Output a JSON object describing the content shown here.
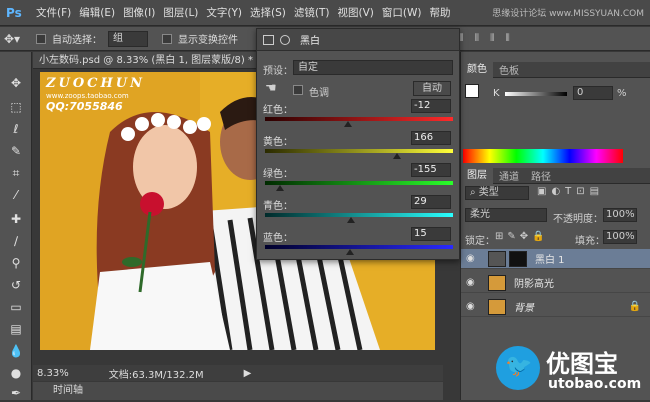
{
  "menubar": {
    "app_logo": "Ps",
    "items": [
      "文件(F)",
      "编辑(E)",
      "图像(I)",
      "图层(L)",
      "文字(Y)",
      "选择(S)",
      "滤镜(T)",
      "视图(V)",
      "窗口(W)",
      "帮助"
    ],
    "watermark": "思缘设计论坛 www.MISSYUAN.COM"
  },
  "options": {
    "auto_select_label": "自动选择：",
    "auto_select_value": "组",
    "transform_label": "显示变换控件"
  },
  "document": {
    "tab_title": "小左数码.psd @ 8.33% (黑白 1, 图层蒙版/8) *",
    "zoom": "8.33%",
    "doc_info": "文档:63.3M/132.2M",
    "timeline": "时间轴",
    "overlay_brand": "ZUOCHUN",
    "overlay_url": "www.zoops.taobao.com",
    "overlay_qq": "QQ:7055846"
  },
  "properties": {
    "title": "黑白",
    "preset_label": "预设：",
    "preset_value": "自定",
    "tint_label": "色调",
    "auto_label": "自动",
    "sliders": [
      {
        "label": "红色：",
        "value": "-12",
        "pos": 0.44,
        "colors": [
          "#2a0000",
          "#ff2a2a"
        ]
      },
      {
        "label": "黄色：",
        "value": "166",
        "pos": 0.7,
        "colors": [
          "#2a2a00",
          "#ffff3a"
        ]
      },
      {
        "label": "绿色：",
        "value": "-155",
        "pos": 0.08,
        "colors": [
          "#002a00",
          "#2aff2a"
        ]
      },
      {
        "label": "青色：",
        "value": "29",
        "pos": 0.46,
        "colors": [
          "#002a2a",
          "#2affff"
        ]
      },
      {
        "label": "蓝色：",
        "value": "15",
        "pos": 0.45,
        "colors": [
          "#00002a",
          "#2a2aff"
        ]
      }
    ]
  },
  "color_panel": {
    "tabs": [
      "颜色",
      "色板"
    ],
    "k_label": "K",
    "k_value": "0",
    "unit": "%"
  },
  "layers_panel": {
    "tabs": [
      "图层",
      "通道",
      "路径"
    ],
    "filter_label": "类型",
    "blend_mode": "柔光",
    "opacity_label": "不透明度：",
    "opacity_value": "100%",
    "lock_label": "锁定：",
    "fill_label": "填充：",
    "fill_value": "100%",
    "layers": [
      {
        "name": "黑白 1",
        "selected": true
      },
      {
        "name": "阴影高光",
        "selected": false
      },
      {
        "name": "背景",
        "selected": false
      }
    ]
  },
  "logo": {
    "name": "优图宝",
    "url": "utobao.com"
  }
}
